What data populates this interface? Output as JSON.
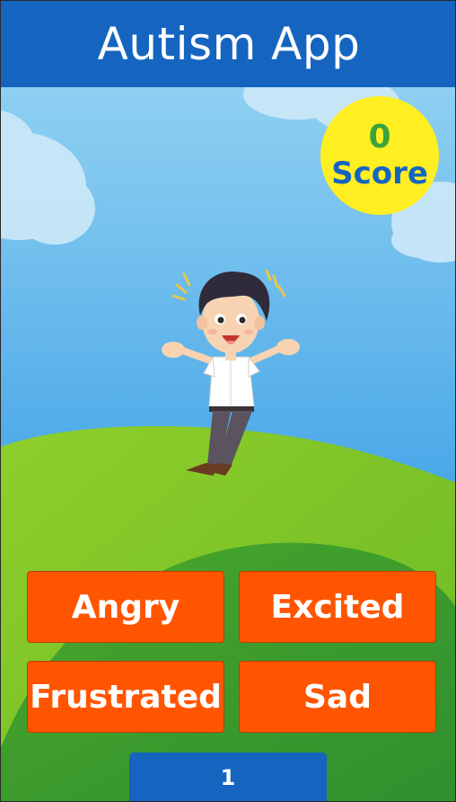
{
  "app": {
    "title": "Autism App"
  },
  "score": {
    "value": "0",
    "label": "Score"
  },
  "question": {
    "image": "excited-boy-illustration"
  },
  "answers": [
    {
      "label": "Angry"
    },
    {
      "label": "Excited"
    },
    {
      "label": "Frustrated"
    },
    {
      "label": "Sad"
    }
  ],
  "pager": {
    "current": "1"
  },
  "colors": {
    "header": "#1565c0",
    "answer_button": "#ff5500",
    "score_badge": "#ffee22",
    "score_value": "#3aa33a",
    "sky": "#4aa8e8",
    "grass": "#5cb82c"
  }
}
